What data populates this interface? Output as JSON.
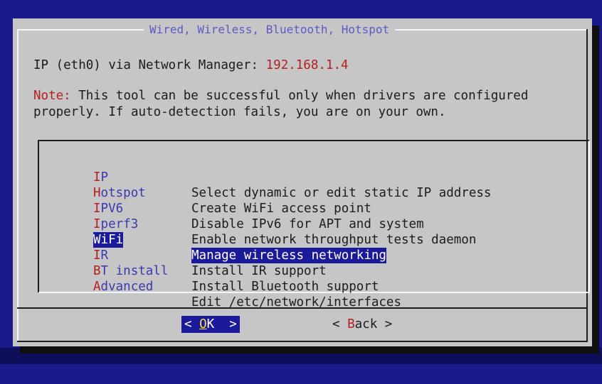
{
  "dialog": {
    "title": "Wired, Wireless, Bluetooth, Hotspot",
    "ip_line_prefix": "IP (eth0) via Network Manager: ",
    "ip_address": "192.168.1.4",
    "note_label": "Note:",
    "note_line1": " This tool can be successful only when drivers are configured",
    "note_line2": "properly. If auto-detection fails, you are on your own."
  },
  "menu": {
    "items": [
      {
        "tag_first": "I",
        "tag_rest": "P",
        "description": "Select dynamic or edit static IP address",
        "selected": false
      },
      {
        "tag_first": "H",
        "tag_rest": "otspot",
        "description": "Create WiFi access point",
        "selected": false
      },
      {
        "tag_first": "I",
        "tag_rest": "PV6",
        "description": "Disable IPv6 for APT and system",
        "selected": false
      },
      {
        "tag_first": "I",
        "tag_rest": "perf3",
        "description": "Enable network throughput tests daemon",
        "selected": false
      },
      {
        "tag_first": "W",
        "tag_rest": "iFi",
        "description": "Manage wireless networking",
        "selected": true
      },
      {
        "tag_first": "I",
        "tag_rest": "R",
        "description": "Install IR support",
        "selected": false
      },
      {
        "tag_first": "B",
        "tag_rest": "T install",
        "description": "Install Bluetooth support",
        "selected": false
      },
      {
        "tag_first": "A",
        "tag_rest": "dvanced",
        "description": "Edit /etc/network/interfaces",
        "selected": false
      }
    ]
  },
  "buttons": {
    "ok_left": "< ",
    "ok_hot": "O",
    "ok_rest": "K  >",
    "back_left": "< ",
    "back_hot": "B",
    "back_rest": "ack >"
  },
  "colors": {
    "screen_background": "#1a1a8c",
    "dialog_background": "#c6c6c6",
    "highlight": "#1a1a9a",
    "accent_red": "#b42020",
    "title_blue": "#5a5ac8"
  }
}
